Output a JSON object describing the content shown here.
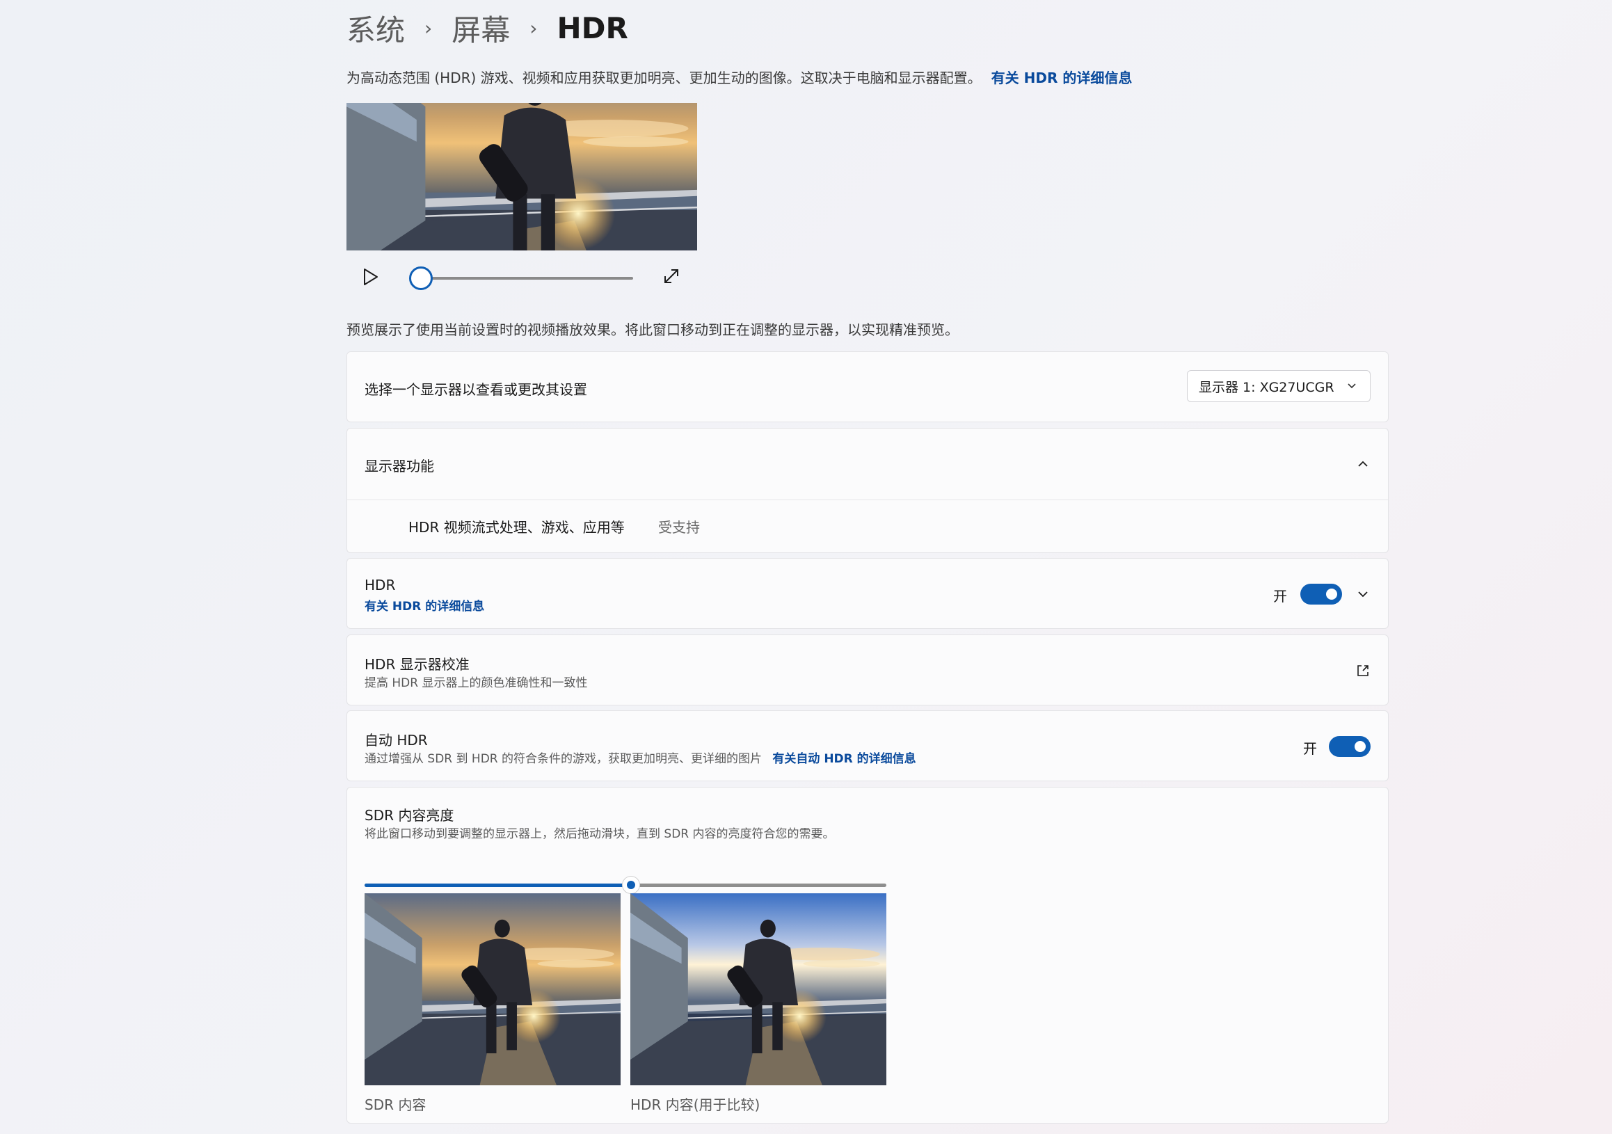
{
  "breadcrumb": {
    "items": [
      "系统",
      "屏幕",
      "HDR"
    ],
    "separator": "›"
  },
  "intro": {
    "text": "为高动态范围 (HDR) 游戏、视频和应用获取更加明亮、更加生动的图像。这取决于电脑和显示器配置。",
    "link": "有关 HDR 的详细信息"
  },
  "preview": {
    "note": "预览展示了使用当前设置时的视频播放效果。将此窗口移动到正在调整的显示器，以实现精准预览。",
    "progress_percent": 0
  },
  "display_select": {
    "label": "选择一个显示器以查看或更改其设置",
    "selected": "显示器 1: XG27UCGR"
  },
  "display_caps": {
    "title": "显示器功能",
    "feature_name": "HDR 视频流式处理、游戏、应用等",
    "feature_status": "受支持"
  },
  "hdr": {
    "title": "HDR",
    "link": "有关 HDR 的详细信息",
    "state": "开"
  },
  "calibration": {
    "title": "HDR 显示器校准",
    "subtitle": "提高 HDR 显示器上的颜色准确性和一致性"
  },
  "auto_hdr": {
    "title": "自动 HDR",
    "subtitle": "通过增强从 SDR 到 HDR 的符合条件的游戏，获取更加明亮、更详细的图片",
    "link": "有关自动 HDR 的详细信息",
    "state": "开"
  },
  "sdr": {
    "title": "SDR 内容亮度",
    "subtitle": "将此窗口移动到要调整的显示器上，然后拖动滑块，直到 SDR 内容的亮度符合您的需要。",
    "slider_percent": 51,
    "sdr_label": "SDR 内容",
    "hdr_label": "HDR 内容(用于比较)"
  },
  "colors": {
    "accent": "#0f5fb5",
    "link": "#0a4a9c"
  }
}
